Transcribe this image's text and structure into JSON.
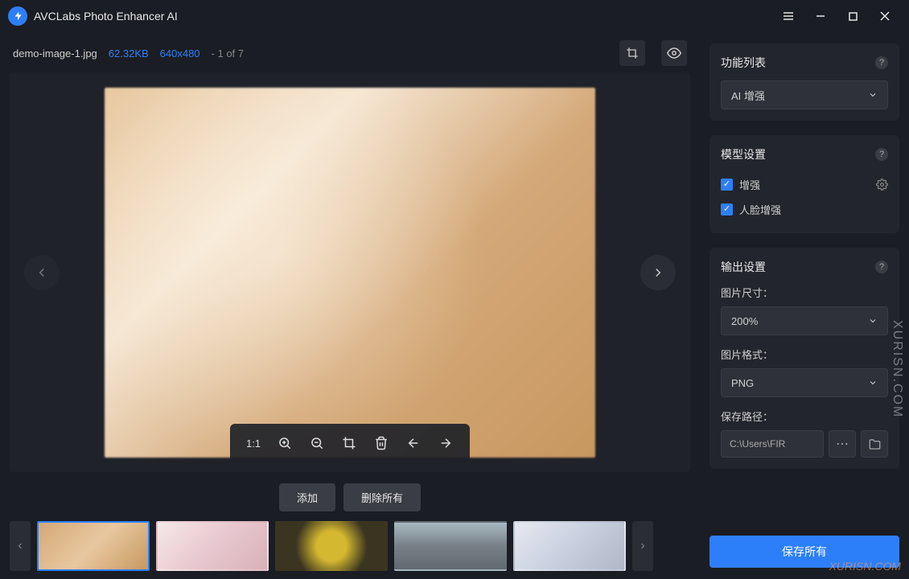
{
  "app": {
    "title": "AVCLabs Photo Enhancer AI"
  },
  "file": {
    "name": "demo-image-1.jpg",
    "size": "62.32KB",
    "dimensions": "640x480",
    "index": "- 1 of 7"
  },
  "toolbar": {
    "ratio_label": "1:1"
  },
  "actions": {
    "add": "添加",
    "delete_all": "删除所有"
  },
  "sidebar": {
    "feature_list": {
      "title": "功能列表",
      "selected": "AI 增强"
    },
    "model_settings": {
      "title": "模型设置",
      "enhance_label": "增强",
      "enhance_checked": true,
      "face_enhance_label": "人脸增强",
      "face_enhance_checked": true
    },
    "output_settings": {
      "title": "输出设置",
      "image_size_label": "图片尺寸：",
      "image_size_value": "200%",
      "image_format_label": "图片格式：",
      "image_format_value": "PNG",
      "save_path_label": "保存路径：",
      "save_path_value": "C:\\Users\\FIR"
    },
    "save_all": "保存所有"
  },
  "watermark": {
    "side": "XURISN.COM",
    "corner": "XURISN.COM"
  }
}
